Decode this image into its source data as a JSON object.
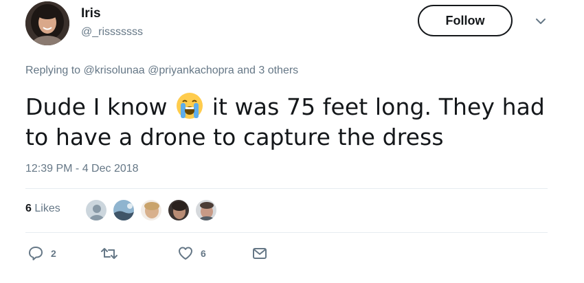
{
  "author": {
    "name": "Iris",
    "handle": "@_risssssss"
  },
  "follow_label": "Follow",
  "reply_context": {
    "prefix": "Replying to",
    "mention_1": "@krisolunaa",
    "mention_2": "@priyankachopra",
    "suffix": "and 3 others"
  },
  "tweet": {
    "text_before_emoji": "Dude I know",
    "emoji": "loudly-crying-face",
    "text_after_emoji": "it was 75 feet long. They had to have a drone to capture the dress"
  },
  "timestamp": "12:39 PM - 4 Dec 2018",
  "likes": {
    "count": "6",
    "label": "Likes"
  },
  "actions": {
    "reply_count": "2",
    "like_count": "6"
  },
  "icons": {
    "reply": "reply-icon",
    "retweet": "retweet-icon",
    "like": "heart-icon",
    "dm": "envelope-icon",
    "menu": "chevron-down-icon"
  },
  "colors": {
    "text_primary": "#14171a",
    "text_secondary": "#657786",
    "divider": "#e6ecf0"
  }
}
